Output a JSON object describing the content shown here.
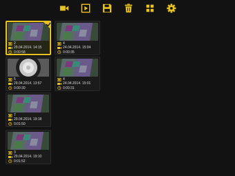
{
  "colors": {
    "accent": "#e8c320",
    "background": "#121212"
  },
  "toolbar": [
    {
      "name": "camera-button",
      "icon": "video-camera-icon"
    },
    {
      "name": "play-button",
      "icon": "play-icon"
    },
    {
      "name": "save-button",
      "icon": "save-icon"
    },
    {
      "name": "delete-button",
      "icon": "trash-icon"
    },
    {
      "name": "grid-view-button",
      "icon": "grid-icon"
    },
    {
      "name": "settings-button",
      "icon": "gear-icon"
    }
  ],
  "recordings": [
    {
      "count": "2",
      "date": "29.04.2014. 14:15",
      "duration": "0:00:58",
      "selected": true
    },
    {
      "count": "4",
      "date": "24.04.2014. 15:04",
      "duration": "0:00:35",
      "selected": false
    },
    {
      "count": "5",
      "date": "29.04.2014. 13:57",
      "duration": "0:00:30",
      "selected": false
    },
    {
      "count": "4",
      "date": "24.04.2014. 15:01",
      "duration": "0:00:31",
      "selected": false
    },
    {
      "count": "7",
      "date": "29.04.2014. 19:18",
      "duration": "0:01:50",
      "selected": false
    },
    {
      "count": "3",
      "date": "29.04.2014. 19:10",
      "duration": "0:01:52",
      "selected": false
    }
  ]
}
